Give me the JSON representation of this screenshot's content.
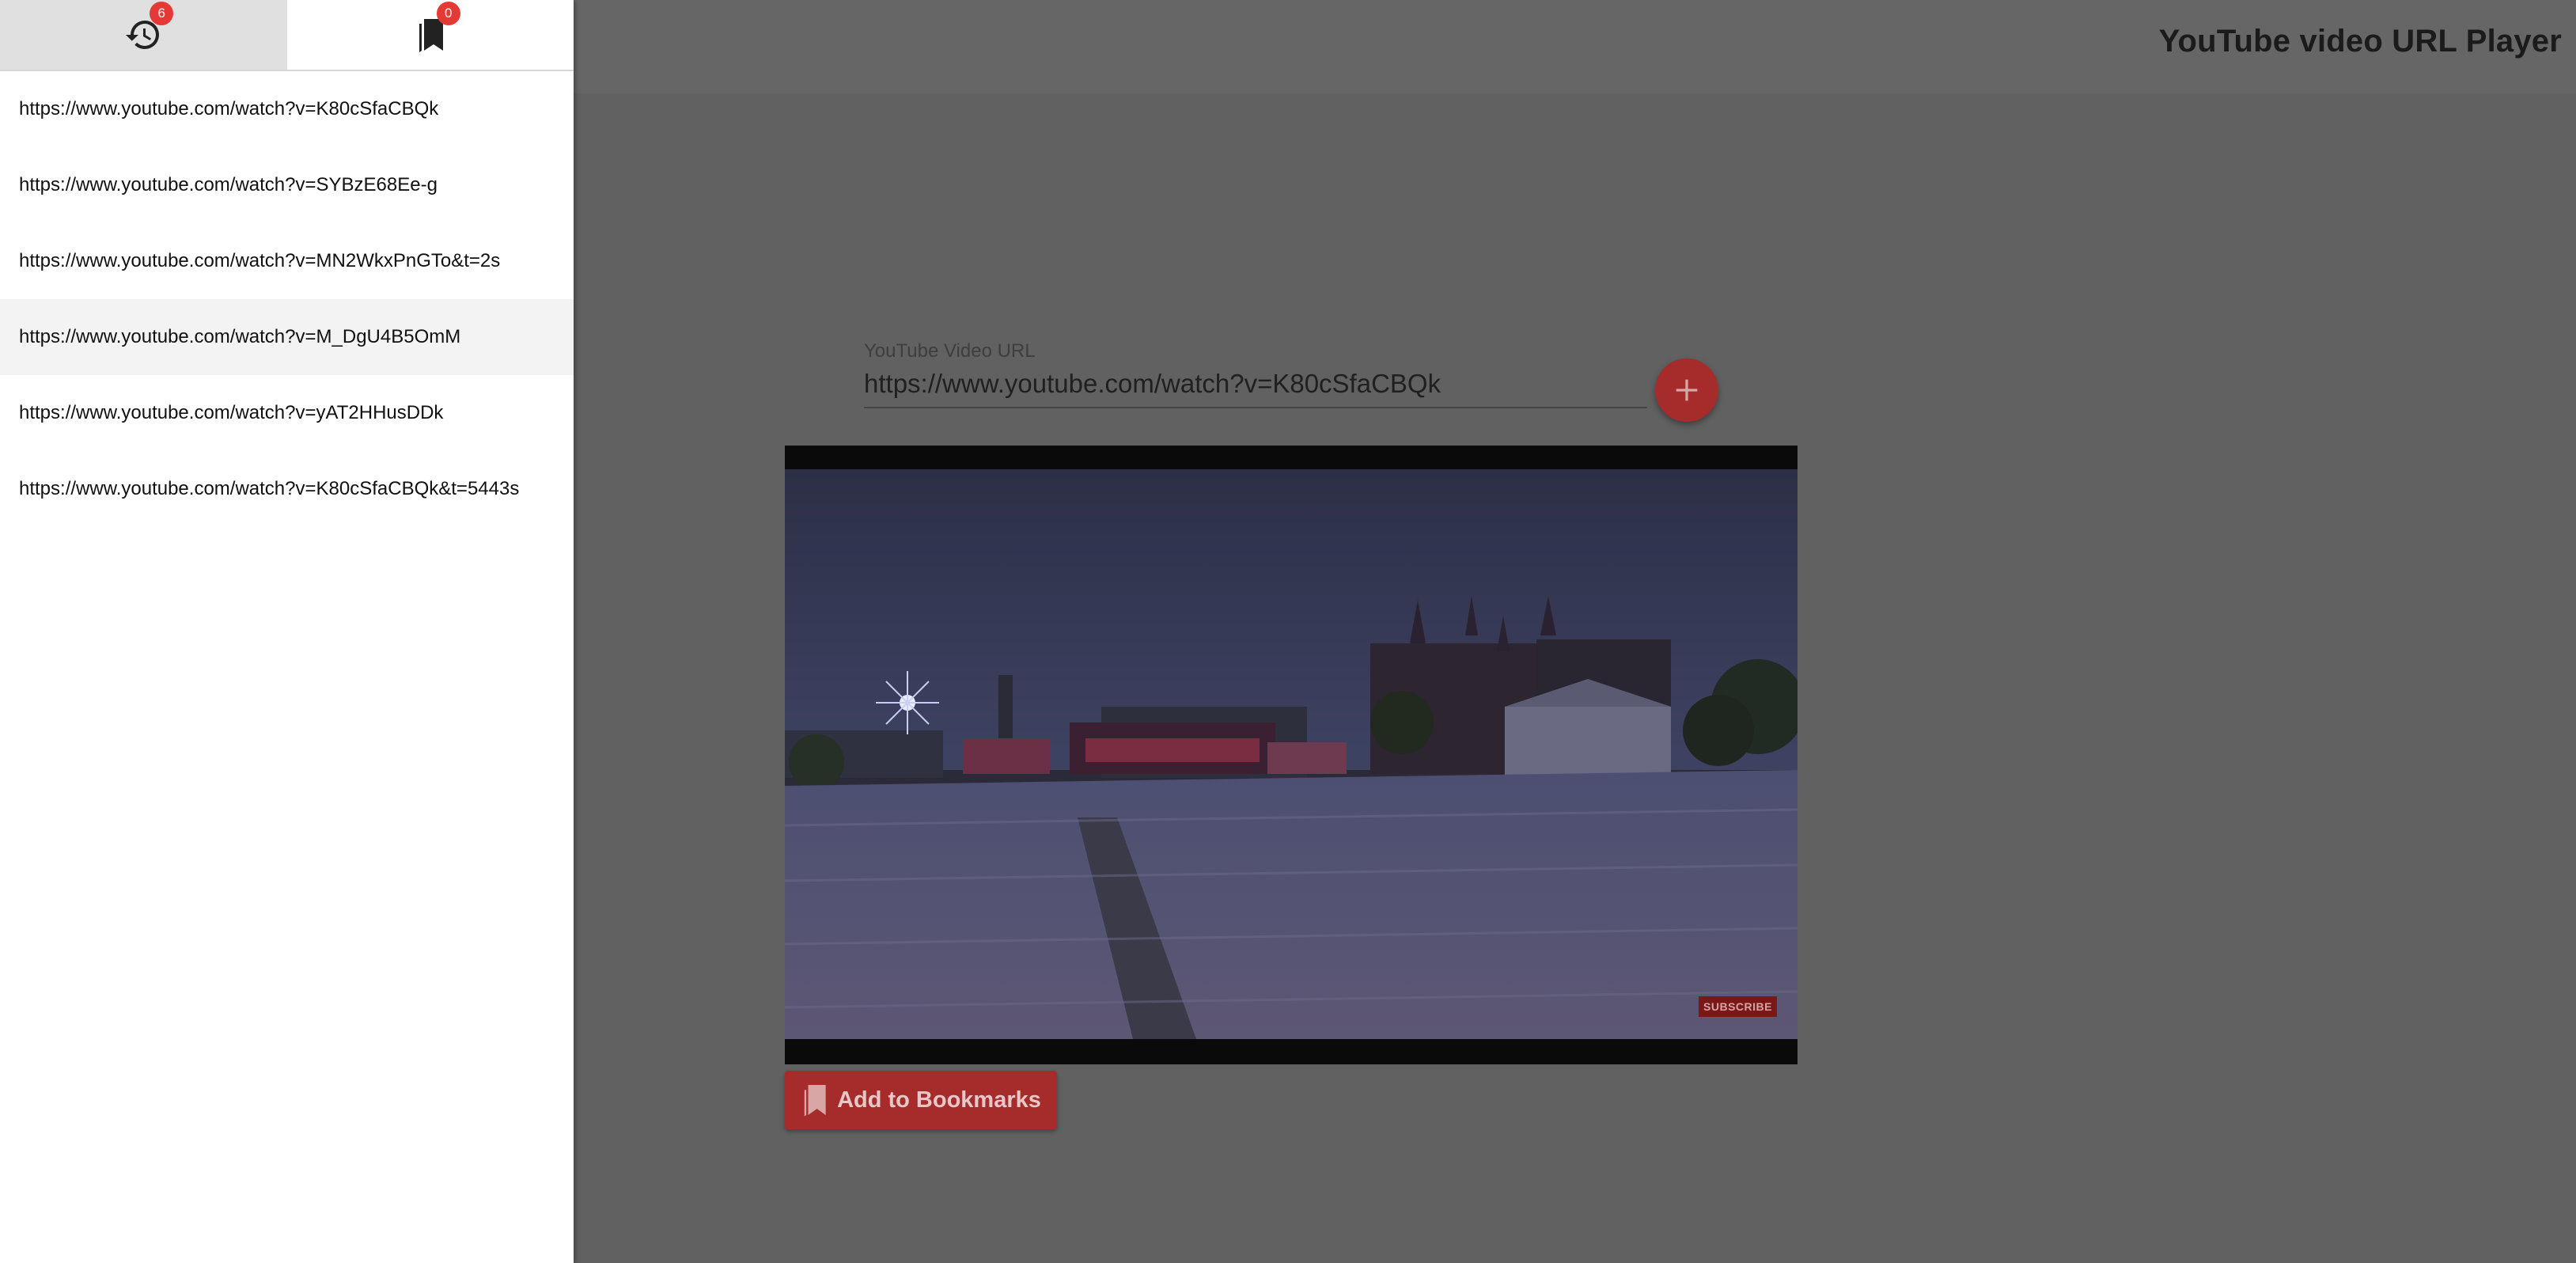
{
  "app": {
    "title": "YouTube video URL Player"
  },
  "url_input": {
    "label": "YouTube Video URL",
    "value": "https://www.youtube.com/watch?v=K80cSfaCBQk",
    "add_icon": "plus-icon"
  },
  "video": {
    "subscribe_label": "SUBSCRIBE"
  },
  "bookmark_button": {
    "label": "Add to Bookmarks",
    "icon": "bookmarks-icon"
  },
  "drawer": {
    "tabs": [
      {
        "name": "history",
        "icon": "history-icon",
        "badge": "6",
        "selected": true
      },
      {
        "name": "bookmarks",
        "icon": "bookmarks-icon",
        "badge": "0",
        "selected": false
      }
    ],
    "history": [
      "https://www.youtube.com/watch?v=K80cSfaCBQk",
      "https://www.youtube.com/watch?v=SYBzE68Ee-g",
      "https://www.youtube.com/watch?v=MN2WkxPnGTo&t=2s",
      "https://www.youtube.com/watch?v=M_DgU4B5OmM",
      "https://www.youtube.com/watch?v=yAT2HHusDDk",
      "https://www.youtube.com/watch?v=K80cSfaCBQk&t=5443s"
    ],
    "hovered_index": 3
  },
  "colors": {
    "accent": "#a62b2b",
    "badge": "#e53935",
    "overlay": "#616161"
  }
}
